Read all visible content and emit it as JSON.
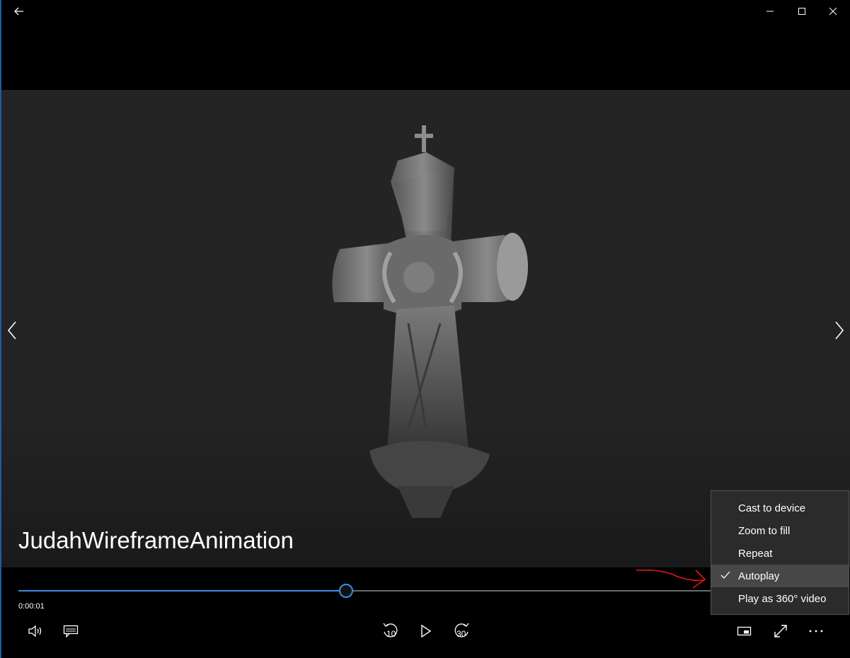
{
  "window": {
    "back_icon": "arrow-left-icon",
    "controls": [
      "minimize-icon",
      "maximize-icon",
      "close-icon"
    ]
  },
  "video": {
    "title": "JudahWireframeAnimation",
    "prev_icon": "chevron-left-icon",
    "next_icon": "chevron-right-icon"
  },
  "playback": {
    "current_time": "0:00:01",
    "progress_fraction": 0.473,
    "accent_color": "#3b8ee6"
  },
  "controls": {
    "left": [
      "volume-icon",
      "subtitles-icon"
    ],
    "center": {
      "skip_back_label": "10",
      "play_icon": "play-icon",
      "skip_forward_label": "30"
    },
    "right": [
      "mini-view-icon",
      "fullscreen-icon",
      "more-options-icon"
    ]
  },
  "more_menu": {
    "items": [
      {
        "label": "Cast to device",
        "checked": false
      },
      {
        "label": "Zoom to fill",
        "checked": false
      },
      {
        "label": "Repeat",
        "checked": false
      },
      {
        "label": "Autoplay",
        "checked": true
      },
      {
        "label": "Play as 360° video",
        "checked": false
      }
    ]
  },
  "annotation": {
    "color": "#e0161a",
    "icon": "red-arrow-annotation"
  }
}
